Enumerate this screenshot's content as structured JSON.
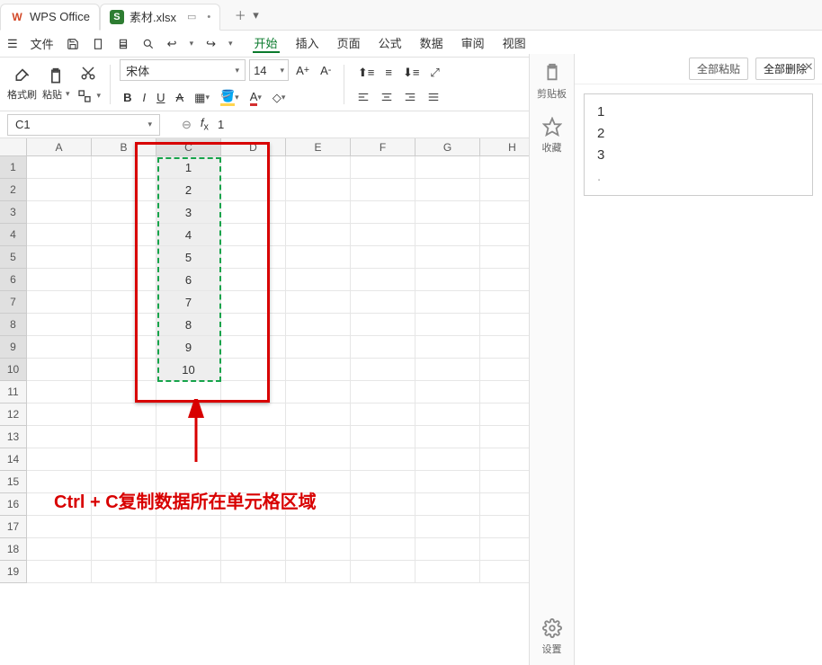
{
  "tabs": {
    "app_name": "WPS Office",
    "file_tab": "素材.xlsx"
  },
  "quickbar": {
    "file_menu": "文件"
  },
  "ribbon": {
    "tabs": [
      "开始",
      "插入",
      "页面",
      "公式",
      "数据",
      "审阅",
      "视图"
    ],
    "active": 0,
    "format_brush": "格式刷",
    "paste": "粘贴",
    "font_name": "宋体",
    "font_size": "14"
  },
  "formula": {
    "namebox": "C1",
    "fx_value": "1"
  },
  "grid": {
    "columns": [
      "A",
      "B",
      "C",
      "D",
      "E",
      "F",
      "G",
      "H"
    ],
    "row_count": 19,
    "data_column_index": 2,
    "selected_column": 2,
    "cells": [
      "1",
      "2",
      "3",
      "4",
      "5",
      "6",
      "7",
      "8",
      "9",
      "10"
    ]
  },
  "annotation": "Ctrl + C复制数据所在单元格区域",
  "sidepane": {
    "clipboard": "剪贴板",
    "favorite": "收藏",
    "settings": "设置"
  },
  "clippane": {
    "paste_all": "全部粘贴",
    "delete_all": "全部删除",
    "items": [
      "1",
      "2",
      "3"
    ]
  }
}
